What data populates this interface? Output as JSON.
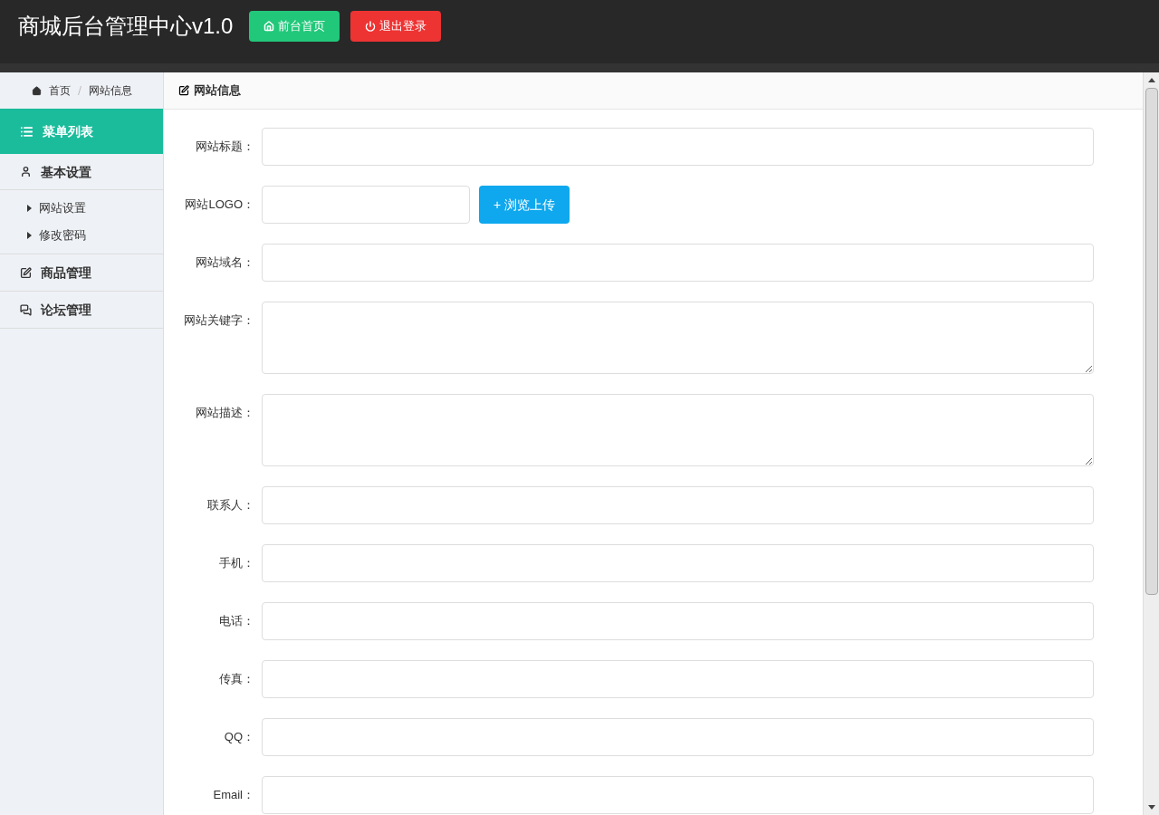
{
  "header": {
    "title": "商城后台管理中心v1.0",
    "buttons": [
      {
        "label": "前台首页",
        "kind": "home"
      },
      {
        "label": "退出登录",
        "kind": "logout"
      }
    ]
  },
  "breadcrumb": [
    "首页",
    "网站信息"
  ],
  "sidebar": {
    "heading": "菜单列表",
    "groups": [
      {
        "label": "基本设置",
        "kind": "user",
        "expanded": true,
        "children": [
          "网站设置",
          "修改密码"
        ]
      },
      {
        "label": "商品管理",
        "kind": "edit",
        "expanded": false
      },
      {
        "label": "论坛管理",
        "kind": "chat",
        "expanded": false
      }
    ]
  },
  "panel": {
    "title": "网站信息"
  },
  "form": [
    {
      "label": "网站标题：",
      "kind": "input"
    },
    {
      "label": "网站LOGO：",
      "kind": "upload",
      "button": "+ 浏览上传"
    },
    {
      "label": "网站域名：",
      "kind": "input"
    },
    {
      "label": "网站关键字：",
      "kind": "textarea"
    },
    {
      "label": "网站描述：",
      "kind": "textarea"
    },
    {
      "label": "联系人：",
      "kind": "input"
    },
    {
      "label": "手机：",
      "kind": "input"
    },
    {
      "label": "电话：",
      "kind": "input"
    },
    {
      "label": "传真：",
      "kind": "input"
    },
    {
      "label": "QQ：",
      "kind": "input"
    },
    {
      "label": "Email：",
      "kind": "input"
    }
  ]
}
